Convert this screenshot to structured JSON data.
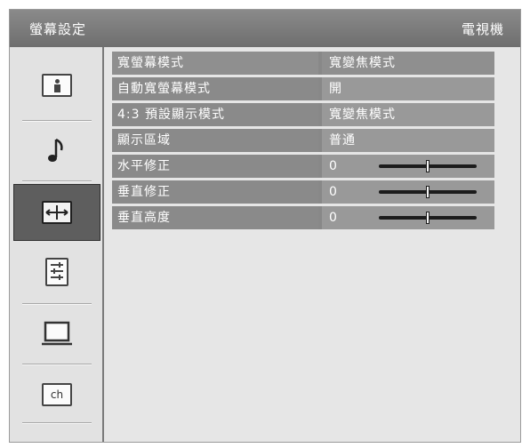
{
  "header": {
    "title": "螢幕設定",
    "source": "電視機"
  },
  "sidebar": {
    "items": [
      {
        "icon": "picture-icon"
      },
      {
        "icon": "music-note-icon"
      },
      {
        "icon": "screen-adjust-icon",
        "selected": true
      },
      {
        "icon": "settings-list-icon"
      },
      {
        "icon": "monitor-icon"
      },
      {
        "icon": "channel-icon",
        "text": "ch"
      }
    ]
  },
  "settings": [
    {
      "label": "寬螢幕模式",
      "value": "寬變焦模式"
    },
    {
      "label": "自動寬螢幕模式",
      "value": "開"
    },
    {
      "label": "4:3 預設顯示模式",
      "value": "寬變焦模式"
    },
    {
      "label": "顯示區域",
      "value": "普通"
    },
    {
      "label": "水平修正",
      "value": "0",
      "slider_fraction": 0.5
    },
    {
      "label": "垂直修正",
      "value": "0",
      "slider_fraction": 0.5
    },
    {
      "label": "垂直高度",
      "value": "0",
      "slider_fraction": 0.5
    }
  ],
  "colors": {
    "titlebar": "#7a7a7a",
    "selected_item": "#5e5e5e",
    "row_label": "#8a8a8a",
    "row_value": "#999999",
    "background": "#e6e6e6"
  }
}
